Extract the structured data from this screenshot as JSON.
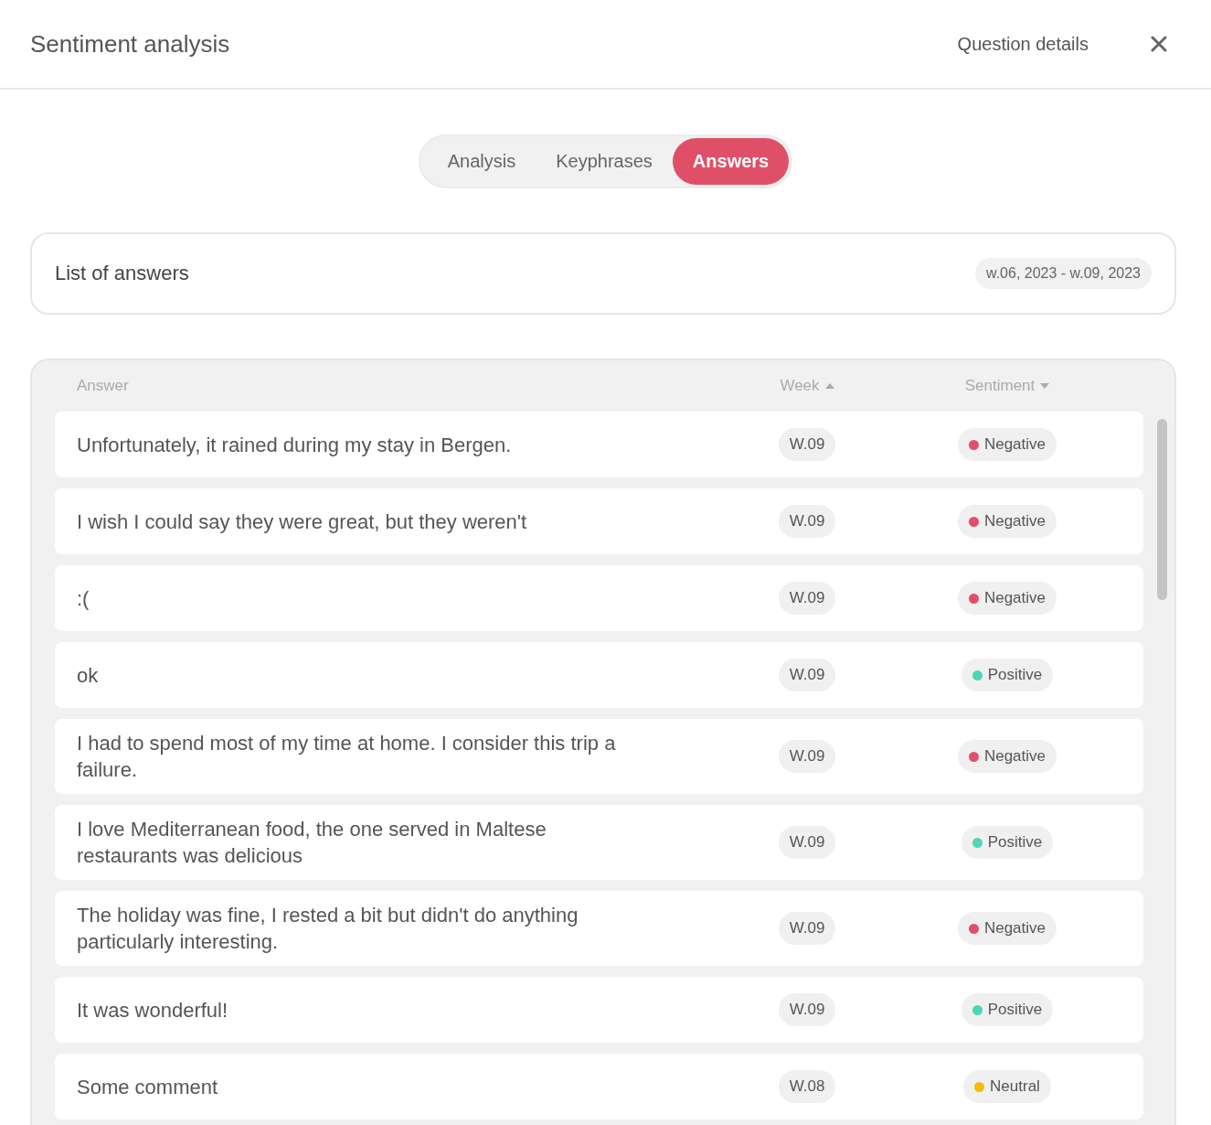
{
  "header": {
    "title": "Sentiment analysis",
    "link": "Question details"
  },
  "tabs": [
    {
      "label": "Analysis",
      "selected": false
    },
    {
      "label": "Keyphrases",
      "selected": false
    },
    {
      "label": "Answers",
      "selected": true
    }
  ],
  "list_card": {
    "title": "List of answers",
    "date_range": "w.06, 2023 - w.09, 2023"
  },
  "table": {
    "columns": [
      {
        "label": "Answer",
        "sorted": false
      },
      {
        "label": "Week",
        "sorted": true,
        "ascending": true
      },
      {
        "label": "Sentiment",
        "sorted": true,
        "ascending": false
      }
    ],
    "rows": [
      {
        "answer": "Unfortunately, it rained during my stay in Bergen.",
        "week": "W.09",
        "sentiment": "Negative",
        "color": "#e0506a"
      },
      {
        "answer": "I wish I could say they were great, but they weren't",
        "week": "W.09",
        "sentiment": "Negative",
        "color": "#e0506a"
      },
      {
        "answer": ":(",
        "week": "W.09",
        "sentiment": "Negative",
        "color": "#e0506a"
      },
      {
        "answer": "ok",
        "week": "W.09",
        "sentiment": "Positive",
        "color": "#4fd6b4"
      },
      {
        "answer": "I had to spend most of my time at home. I consider this trip a failure.",
        "week": "W.09",
        "sentiment": "Negative",
        "color": "#e0506a"
      },
      {
        "answer": "I love Mediterranean food, the one served in Maltese restaurants was delicious",
        "week": "W.09",
        "sentiment": "Positive",
        "color": "#4fd6b4"
      },
      {
        "answer": "The holiday was fine, I rested a bit but didn't do anything particularly interesting.",
        "week": "W.09",
        "sentiment": "Negative",
        "color": "#e0506a"
      },
      {
        "answer": "It was wonderful!",
        "week": "W.09",
        "sentiment": "Positive",
        "color": "#4fd6b4"
      },
      {
        "answer": "Some comment",
        "week": "W.08",
        "sentiment": "Neutral",
        "color": "#fbb800"
      }
    ]
  }
}
